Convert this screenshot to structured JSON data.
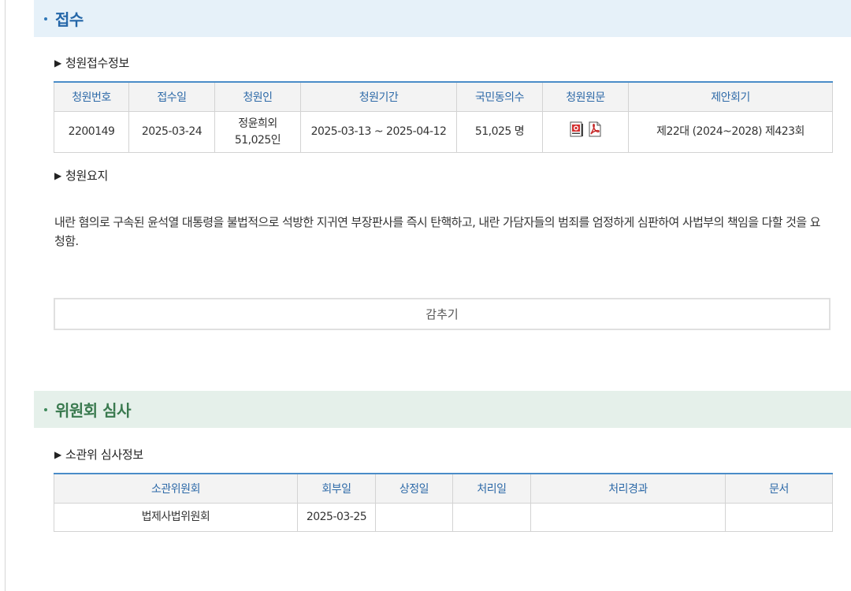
{
  "reception": {
    "section_title": "접수",
    "info_heading": "청원접수정보",
    "table": {
      "headers": [
        "청원번호",
        "접수일",
        "청원인",
        "청원기간",
        "국민동의수",
        "청원원문",
        "제안회기"
      ],
      "row": {
        "number": "2200149",
        "date": "2025-03-24",
        "petitioner_line1": "정윤희외",
        "petitioner_line2": "51,025인",
        "period": "2025-03-13 ~ 2025-04-12",
        "consent_count": "51,025 명",
        "docs": [
          "hwp-file-icon",
          "pdf-file-icon"
        ],
        "session": "제22대 (2024~2028) 제423회"
      }
    },
    "summary_heading": "청원요지",
    "summary_text": "내란 혐의로 구속된 윤석열 대통령을 불법적으로 석방한 지귀연 부장판사를 즉시 탄핵하고, 내란 가담자들의 범죄를 엄정하게 심판하여 사법부의 책임을 다할 것을 요청함.",
    "toggle_label": "감추기"
  },
  "committee": {
    "section_title": "위원회 심사",
    "info_heading": "소관위 심사정보",
    "table": {
      "headers": [
        "소관위원회",
        "회부일",
        "상정일",
        "처리일",
        "처리경과",
        "문서"
      ],
      "row": {
        "committee": "법제사법위원회",
        "referral_date": "2025-03-25",
        "agenda_date": "",
        "processed_date": "",
        "result": "",
        "document": ""
      }
    }
  },
  "colors": {
    "reception_header_bg": "#e6f1f9",
    "committee_header_bg": "#e5f0ea",
    "table_top_border": "#4a8cc8",
    "header_text": "#2e6aa8"
  }
}
